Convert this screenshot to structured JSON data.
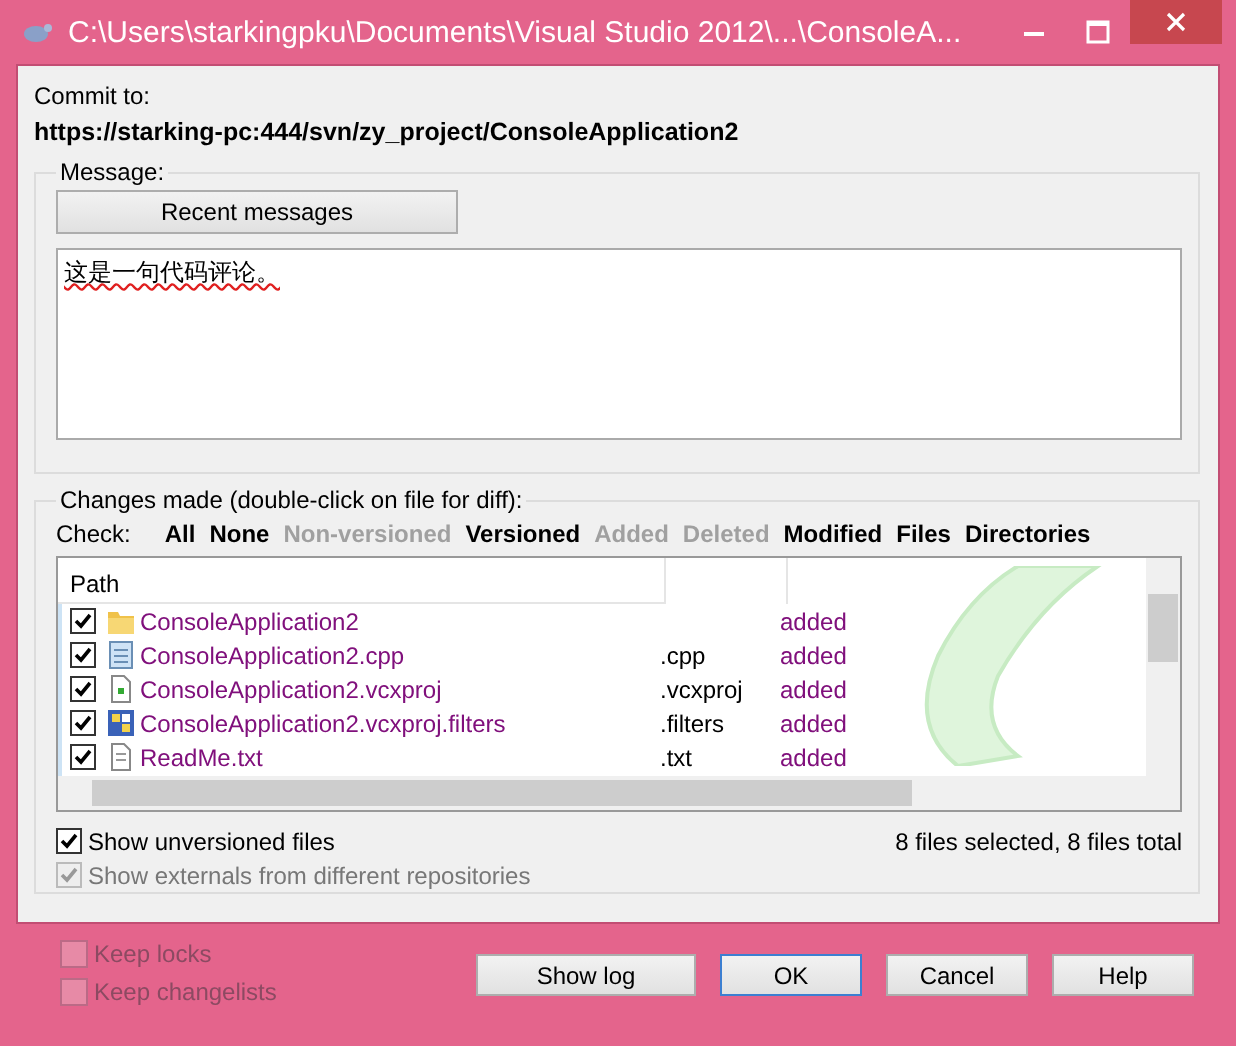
{
  "window": {
    "title": "C:\\Users\\starkingpku\\Documents\\Visual Studio 2012\\...\\ConsoleA..."
  },
  "commit_to": {
    "label": "Commit to:",
    "url": "https://starking-pc:444/svn/zy_project/ConsoleApplication2"
  },
  "message": {
    "legend": "Message:",
    "recent_button": "Recent messages",
    "value": "这是一句代码评论。"
  },
  "changes": {
    "legend": "Changes made (double-click on file for diff):",
    "check_label": "Check:",
    "filters": [
      {
        "label": "All",
        "disabled": false
      },
      {
        "label": "None",
        "disabled": false
      },
      {
        "label": "Non-versioned",
        "disabled": true
      },
      {
        "label": "Versioned",
        "disabled": false
      },
      {
        "label": "Added",
        "disabled": true
      },
      {
        "label": "Deleted",
        "disabled": true
      },
      {
        "label": "Modified",
        "disabled": false
      },
      {
        "label": "Files",
        "disabled": false
      },
      {
        "label": "Directories",
        "disabled": false
      }
    ],
    "columns": [
      "Path"
    ],
    "rows": [
      {
        "checked": true,
        "kind": "folder",
        "path": "ConsoleApplication2",
        "status": "added"
      },
      {
        "checked": true,
        "kind": "source",
        "path": "ConsoleApplication2.cpp",
        "extension": ".cpp",
        "status": "added"
      },
      {
        "checked": true,
        "kind": "project",
        "path": "ConsoleApplication2.vcxproj",
        "extension": ".vcxproj",
        "status": "added"
      },
      {
        "checked": true,
        "kind": "filters",
        "path": "ConsoleApplication2.vcxproj.filters",
        "extension": ".filters",
        "status": "added"
      },
      {
        "checked": true,
        "kind": "text",
        "path": "ReadMe.txt",
        "extension": ".txt",
        "status": "added"
      }
    ],
    "options": [
      {
        "label": "Show unversioned files",
        "checked": true,
        "disabled": false
      },
      {
        "label": "Show externals from different repositories",
        "checked": true,
        "disabled": true
      }
    ],
    "summary": "8 files selected, 8 files total"
  },
  "keep_options": [
    {
      "label": "Keep locks",
      "checked": false,
      "disabled": true
    },
    {
      "label": "Keep changelists",
      "checked": false,
      "disabled": true
    }
  ],
  "buttons": [
    {
      "label": "Show log",
      "default": false
    },
    {
      "label": "OK",
      "default": true
    },
    {
      "label": "Cancel",
      "default": false
    },
    {
      "label": "Help",
      "default": false
    }
  ]
}
